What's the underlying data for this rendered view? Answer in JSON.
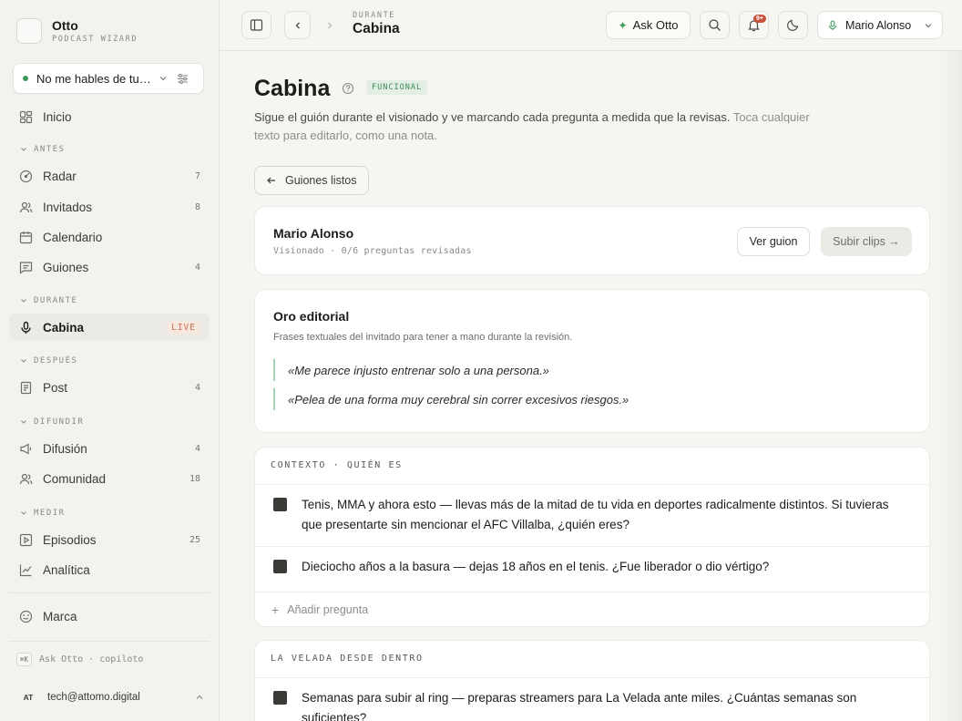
{
  "brand": {
    "name": "Otto",
    "subtitle": "PODCAST WIZARD"
  },
  "podcast_selector": {
    "value": "No me hables de tu L..."
  },
  "nav": {
    "inicio": "Inicio",
    "sections": {
      "antes": "ANTES",
      "durante": "DURANTE",
      "despues": "DESPUÉS",
      "difundir": "DIFUNDIR",
      "medir": "MEDIR"
    },
    "items": [
      {
        "label": "Radar",
        "count": "7"
      },
      {
        "label": "Invitados",
        "count": "8"
      },
      {
        "label": "Calendario",
        "count": ""
      },
      {
        "label": "Guiones",
        "count": "4"
      },
      {
        "label": "Cabina",
        "badge": "LIVE"
      },
      {
        "label": "Post",
        "count": "4"
      },
      {
        "label": "Difusión",
        "count": "4"
      },
      {
        "label": "Comunidad",
        "count": "18"
      },
      {
        "label": "Episodios",
        "count": "25"
      },
      {
        "label": "Analítica",
        "count": ""
      }
    ],
    "marca": "Marca"
  },
  "ask_hint": {
    "kbd": "⌘K",
    "text": "Ask Otto · copiloto"
  },
  "user": {
    "initials": "AT",
    "email": "tech@attomo.digital"
  },
  "topbar": {
    "crumb_sub": "DURANTE",
    "crumb": "Cabina",
    "ask_label": "Ask Otto",
    "notif_count": "9+",
    "user_name": "Mario Alonso"
  },
  "page": {
    "title": "Cabina",
    "badge": "FUNCIONAL",
    "desc": "Sigue el guión durante el visionado y ve marcando cada pregunta a medida que la revisas.",
    "desc_muted": "Toca cualquier texto para editarlo, como una nota.",
    "back_label": "Guiones listos"
  },
  "guest_card": {
    "name": "Mario Alonso",
    "meta": "Visionado · 0/6 preguntas revisadas",
    "ver_label": "Ver guion",
    "subir_label": "Subir clips →"
  },
  "oro": {
    "title": "Oro editorial",
    "desc": "Frases textuales del invitado para tener a mano durante la revisión.",
    "quotes": [
      "«Me parece injusto entrenar solo a una persona.»",
      "«Pelea de una forma muy cerebral sin correr excesivos riesgos.»"
    ]
  },
  "contexto": {
    "header": "CONTEXTO · QUIÉN ES",
    "questions": [
      "Tenis, MMA y ahora esto — llevas más de la mitad de tu vida en deportes radicalmente distintos. Si tuvieras que presentarte sin mencionar el AFC Villalba, ¿quién eres?",
      "Dieciocho años a la basura — dejas 18 años en el tenis. ¿Fue liberador o dio vértigo?"
    ],
    "add_label": "Añadir pregunta"
  },
  "velada": {
    "header": "LA VELADA DESDE DENTRO",
    "questions": [
      "Semanas para subir al ring — preparas streamers para La Velada ante miles. ¿Cuántas semanas son suficientes?"
    ]
  },
  "colors": {
    "accent_green": "#3e9a5c",
    "live": "#c76e50",
    "notif": "#c94f3a"
  }
}
